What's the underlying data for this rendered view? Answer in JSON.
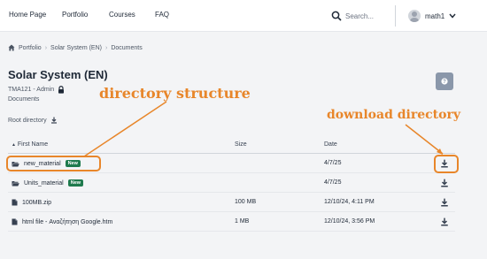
{
  "nav": {
    "links": [
      "Home Page",
      "Portfolio",
      "Courses",
      "FAQ"
    ],
    "search_placeholder": "Search...",
    "user_name": "math1"
  },
  "breadcrumb": {
    "items": [
      "Portfolio",
      "Solar System (EN)",
      "Documents"
    ]
  },
  "page": {
    "title": "Solar System (EN)",
    "meta": "TMA121 - Admin",
    "section": "Documents",
    "root_directory": "Root directory"
  },
  "table": {
    "headers": {
      "name": "First Name",
      "size": "Size",
      "date": "Date"
    },
    "rows": [
      {
        "name": "new_material",
        "type": "folder",
        "badge": "New",
        "size": "",
        "date": "4/7/25"
      },
      {
        "name": "Units_material",
        "type": "folder",
        "badge": "New",
        "size": "",
        "date": "4/7/25"
      },
      {
        "name": "100MB.zip",
        "type": "file",
        "badge": "",
        "size": "100 MB",
        "date": "12/10/24, 4:11 PM"
      },
      {
        "name": "html file - Αναζήτηση Google.htm",
        "type": "file",
        "badge": "",
        "size": "1 MB",
        "date": "12/10/24, 3:56 PM"
      }
    ]
  },
  "annotations": {
    "directory_structure": "directory structure",
    "download_directory": "download directory"
  },
  "colors": {
    "annotation": "#e8862a",
    "badge": "#1f7a4d",
    "help_button": "#8a97aa"
  }
}
